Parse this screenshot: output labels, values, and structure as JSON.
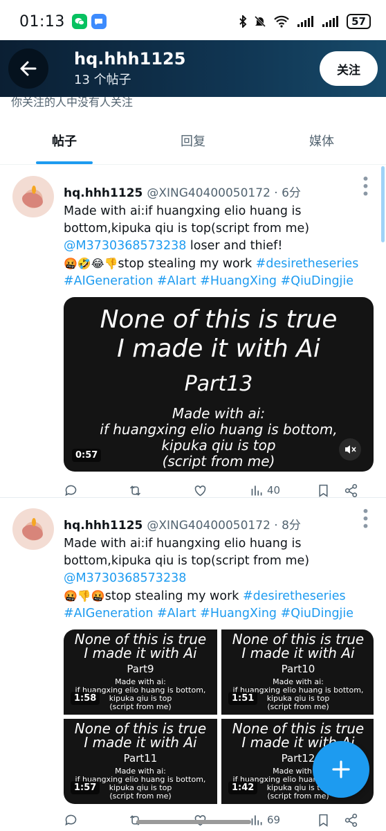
{
  "status": {
    "time": "01:13",
    "battery": "57"
  },
  "header": {
    "name": "hq.hhh1125",
    "count": "13 个帖子",
    "follow": "关注"
  },
  "cut_text": "你关注的人中没有人关注",
  "tabs": [
    "帖子",
    "回复",
    "媒体"
  ],
  "posts": [
    {
      "name": "hq.hhh1125",
      "handle": "@XING40400050172 · 6分",
      "text1": "Made with ai:if huangxing elio huang is bottom,kipuka qiu is top(script from me)",
      "mention": "@M3730368573238",
      "text2": " loser and thief!",
      "emojis": "🤬🤣😂👎",
      "text3": "stop stealing my work ",
      "tags": [
        "#desiretheseries",
        "#AIGeneration",
        "#AIart",
        "#HuangXing",
        "#QiuDingjie"
      ],
      "video": {
        "line1": "None of this is true",
        "line2": "I made it with Ai",
        "part": "Part13",
        "sub1": "Made with ai:",
        "sub2": "if huangxing elio huang is bottom,",
        "sub3": "kipuka qiu is top",
        "sub4": "(script from me)",
        "duration": "0:57"
      },
      "views": "40"
    },
    {
      "name": "hq.hhh1125",
      "handle": "@XING40400050172 · 8分",
      "text1": "Made with ai:if huangxing elio huang is bottom,kipuka qiu is top(script from me)",
      "mention": "@M3730368573238",
      "emojis": "🤬👎🤬",
      "text3": "stop stealing my work ",
      "tags": [
        "#desiretheseries",
        "#AIGeneration",
        "#AIart",
        "#HuangXing",
        "#QiuDingjie"
      ],
      "tiles": [
        {
          "line1": "None of this is true",
          "line2": "I made it with Ai",
          "part": "Part9",
          "sub1": "Made with ai:",
          "sub2": "if huangxing elio huang is bottom,",
          "sub3": "kipuka qiu is top",
          "sub4": "(script from me)",
          "duration": "1:58"
        },
        {
          "line1": "None of this is true",
          "line2": "I made it with Ai",
          "part": "Part10",
          "sub1": "Made with ai:",
          "sub2": "if huangxing elio huang is bottom,",
          "sub3": "kipuka qiu is top",
          "sub4": "(script from me)",
          "duration": "1:51"
        },
        {
          "line1": "None of this is true",
          "line2": "I made it with Ai",
          "part": "Part11",
          "sub1": "Made with ai:",
          "sub2": "if huangxing elio huang is bottom,",
          "sub3": "kipuka qiu is top",
          "sub4": "(script from me)",
          "duration": "1:57"
        },
        {
          "line1": "None of this is true",
          "line2": "I made it with Ai",
          "part": "Part12",
          "sub1": "Made with ai:",
          "sub2": "if huangxing elio huang is bottom,",
          "sub3": "kipuka qiu is top",
          "sub4": "(script from me)",
          "duration": "1:42"
        }
      ],
      "views": "69"
    }
  ],
  "colors": {
    "accent": "#1d9bf0",
    "header_dark": "#0b1f33"
  }
}
